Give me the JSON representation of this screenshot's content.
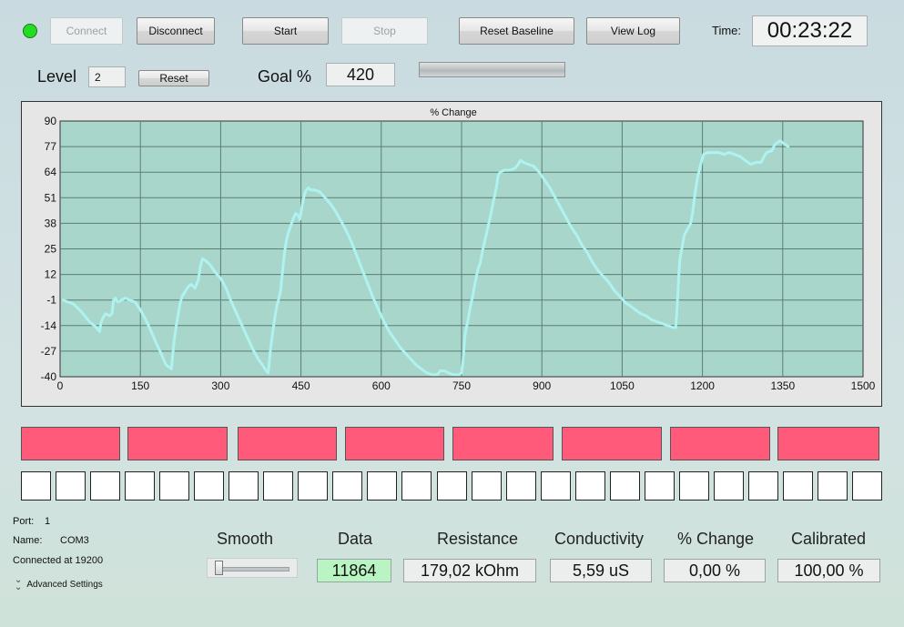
{
  "toolbar": {
    "connect_label": "Connect",
    "disconnect_label": "Disconnect",
    "start_label": "Start",
    "stop_label": "Stop",
    "reset_baseline_label": "Reset Baseline",
    "view_log_label": "View Log",
    "time_label": "Time:",
    "time_value": "00:23:22",
    "status_color": "#22dd22"
  },
  "controls": {
    "level_label": "Level",
    "level_value": "2",
    "reset_label": "Reset",
    "goal_label": "Goal %",
    "goal_value": "420",
    "goal_progress": 0
  },
  "chart_data": {
    "type": "line",
    "title": "% Change",
    "xlabel": "",
    "ylabel": "",
    "xlim": [
      0,
      1500
    ],
    "ylim": [
      -40,
      90
    ],
    "xticks": [
      "0",
      "150",
      "300",
      "450",
      "600",
      "750",
      "900",
      "1050",
      "1200",
      "1350",
      "1500"
    ],
    "yticks": [
      "90",
      "77",
      "64",
      "51",
      "38",
      "25",
      "12",
      "-1",
      "-14",
      "-27",
      "-40"
    ],
    "grid": true,
    "series": [
      {
        "color": "#aef3f0",
        "points": [
          [
            5,
            -1
          ],
          [
            15,
            -2
          ],
          [
            25,
            -3
          ],
          [
            40,
            -7
          ],
          [
            55,
            -12
          ],
          [
            68,
            -15
          ],
          [
            74,
            -17
          ],
          [
            76,
            -13
          ],
          [
            80,
            -10
          ],
          [
            85,
            -8
          ],
          [
            92,
            -9
          ],
          [
            97,
            -8
          ],
          [
            100,
            -1
          ],
          [
            103,
            0
          ],
          [
            108,
            -2
          ],
          [
            115,
            -1
          ],
          [
            122,
            0
          ],
          [
            130,
            -1
          ],
          [
            140,
            -2
          ],
          [
            150,
            -6
          ],
          [
            160,
            -11
          ],
          [
            170,
            -17
          ],
          [
            180,
            -23
          ],
          [
            190,
            -29
          ],
          [
            198,
            -34
          ],
          [
            208,
            -36
          ],
          [
            210,
            -30
          ],
          [
            213,
            -22
          ],
          [
            217,
            -14
          ],
          [
            221,
            -8
          ],
          [
            224,
            -3
          ],
          [
            228,
            1
          ],
          [
            233,
            3
          ],
          [
            240,
            6
          ],
          [
            245,
            7
          ],
          [
            252,
            5
          ],
          [
            258,
            9
          ],
          [
            262,
            16
          ],
          [
            266,
            20
          ],
          [
            272,
            19
          ],
          [
            280,
            17
          ],
          [
            290,
            13
          ],
          [
            300,
            10
          ],
          [
            310,
            5
          ],
          [
            320,
            -2
          ],
          [
            330,
            -8
          ],
          [
            340,
            -14
          ],
          [
            350,
            -20
          ],
          [
            360,
            -26
          ],
          [
            370,
            -31
          ],
          [
            378,
            -34
          ],
          [
            385,
            -37
          ],
          [
            389,
            -38
          ],
          [
            391,
            -32
          ],
          [
            393,
            -26
          ],
          [
            396,
            -20
          ],
          [
            400,
            -12
          ],
          [
            404,
            -5
          ],
          [
            408,
            -1
          ],
          [
            412,
            4
          ],
          [
            415,
            12
          ],
          [
            418,
            20
          ],
          [
            422,
            28
          ],
          [
            426,
            33
          ],
          [
            430,
            36
          ],
          [
            435,
            40
          ],
          [
            440,
            43
          ],
          [
            445,
            42
          ],
          [
            448,
            40
          ],
          [
            451,
            45
          ],
          [
            454,
            50
          ],
          [
            457,
            53
          ],
          [
            460,
            55
          ],
          [
            464,
            56
          ],
          [
            468,
            55
          ],
          [
            475,
            55
          ],
          [
            485,
            54
          ],
          [
            495,
            51
          ],
          [
            505,
            48
          ],
          [
            515,
            44
          ],
          [
            525,
            39
          ],
          [
            535,
            34
          ],
          [
            545,
            28
          ],
          [
            555,
            21
          ],
          [
            565,
            14
          ],
          [
            575,
            7
          ],
          [
            585,
            0
          ],
          [
            595,
            -6
          ],
          [
            605,
            -12
          ],
          [
            615,
            -17
          ],
          [
            625,
            -21
          ],
          [
            635,
            -25
          ],
          [
            645,
            -28
          ],
          [
            655,
            -31
          ],
          [
            665,
            -34
          ],
          [
            675,
            -36
          ],
          [
            685,
            -38
          ],
          [
            695,
            -39
          ],
          [
            705,
            -39
          ],
          [
            710,
            -37
          ],
          [
            718,
            -37
          ],
          [
            725,
            -38
          ],
          [
            735,
            -39
          ],
          [
            745,
            -39
          ],
          [
            750,
            -38
          ],
          [
            752,
            -34
          ],
          [
            754,
            -27
          ],
          [
            756,
            -20
          ],
          [
            759,
            -15
          ],
          [
            763,
            -10
          ],
          [
            766,
            -5
          ],
          [
            770,
            0
          ],
          [
            774,
            6
          ],
          [
            777,
            10
          ],
          [
            780,
            14
          ],
          [
            785,
            18
          ],
          [
            790,
            25
          ],
          [
            795,
            31
          ],
          [
            800,
            37
          ],
          [
            805,
            43
          ],
          [
            810,
            50
          ],
          [
            815,
            56
          ],
          [
            818,
            62
          ],
          [
            822,
            64
          ],
          [
            830,
            65
          ],
          [
            840,
            65
          ],
          [
            850,
            66
          ],
          [
            856,
            68
          ],
          [
            860,
            70
          ],
          [
            866,
            69
          ],
          [
            875,
            68
          ],
          [
            885,
            67
          ],
          [
            895,
            64
          ],
          [
            905,
            60
          ],
          [
            915,
            56
          ],
          [
            925,
            51
          ],
          [
            935,
            46
          ],
          [
            945,
            41
          ],
          [
            955,
            36
          ],
          [
            965,
            32
          ],
          [
            975,
            27
          ],
          [
            985,
            23
          ],
          [
            995,
            18
          ],
          [
            1005,
            14
          ],
          [
            1015,
            11
          ],
          [
            1025,
            8
          ],
          [
            1035,
            4
          ],
          [
            1045,
            1
          ],
          [
            1055,
            -2
          ],
          [
            1065,
            -4
          ],
          [
            1075,
            -6
          ],
          [
            1085,
            -8
          ],
          [
            1095,
            -9
          ],
          [
            1105,
            -11
          ],
          [
            1115,
            -12
          ],
          [
            1125,
            -13
          ],
          [
            1135,
            -14
          ],
          [
            1145,
            -15
          ],
          [
            1150,
            -15
          ],
          [
            1152,
            -8
          ],
          [
            1154,
            2
          ],
          [
            1156,
            12
          ],
          [
            1158,
            20
          ],
          [
            1162,
            26
          ],
          [
            1166,
            32
          ],
          [
            1172,
            35
          ],
          [
            1178,
            38
          ],
          [
            1182,
            44
          ],
          [
            1186,
            53
          ],
          [
            1190,
            60
          ],
          [
            1194,
            65
          ],
          [
            1198,
            69
          ],
          [
            1202,
            73
          ],
          [
            1210,
            74
          ],
          [
            1220,
            74
          ],
          [
            1230,
            74
          ],
          [
            1240,
            73
          ],
          [
            1250,
            74
          ],
          [
            1260,
            73
          ],
          [
            1270,
            72
          ],
          [
            1280,
            70
          ],
          [
            1285,
            69
          ],
          [
            1290,
            68
          ],
          [
            1300,
            69
          ],
          [
            1310,
            69
          ],
          [
            1315,
            72
          ],
          [
            1320,
            74
          ],
          [
            1330,
            75
          ],
          [
            1335,
            78
          ],
          [
            1340,
            79
          ],
          [
            1345,
            80
          ],
          [
            1350,
            79
          ],
          [
            1355,
            78
          ],
          [
            1360,
            77
          ]
        ]
      }
    ]
  },
  "indicators": {
    "red_count": 8,
    "white_count": 25,
    "red_color": "#ff5a79"
  },
  "connection": {
    "port_label": "Port:",
    "port_value": "1",
    "name_label": "Name:",
    "name_value": "COM3",
    "connected_text": "Connected at 19200",
    "advanced_label": "Advanced Settings"
  },
  "metrics": {
    "smooth_label": "Smooth",
    "smooth_value": 0,
    "data_label": "Data",
    "data_value": "11864",
    "resistance_label": "Resistance",
    "resistance_value": "179,02 kOhm",
    "conductivity_label": "Conductivity",
    "conductivity_value": "5,59 uS",
    "pct_change_label": "% Change",
    "pct_change_value": "0,00 %",
    "calibrated_label": "Calibrated",
    "calibrated_value": "100,00 %",
    "data_bg": "#b8f5c2"
  }
}
